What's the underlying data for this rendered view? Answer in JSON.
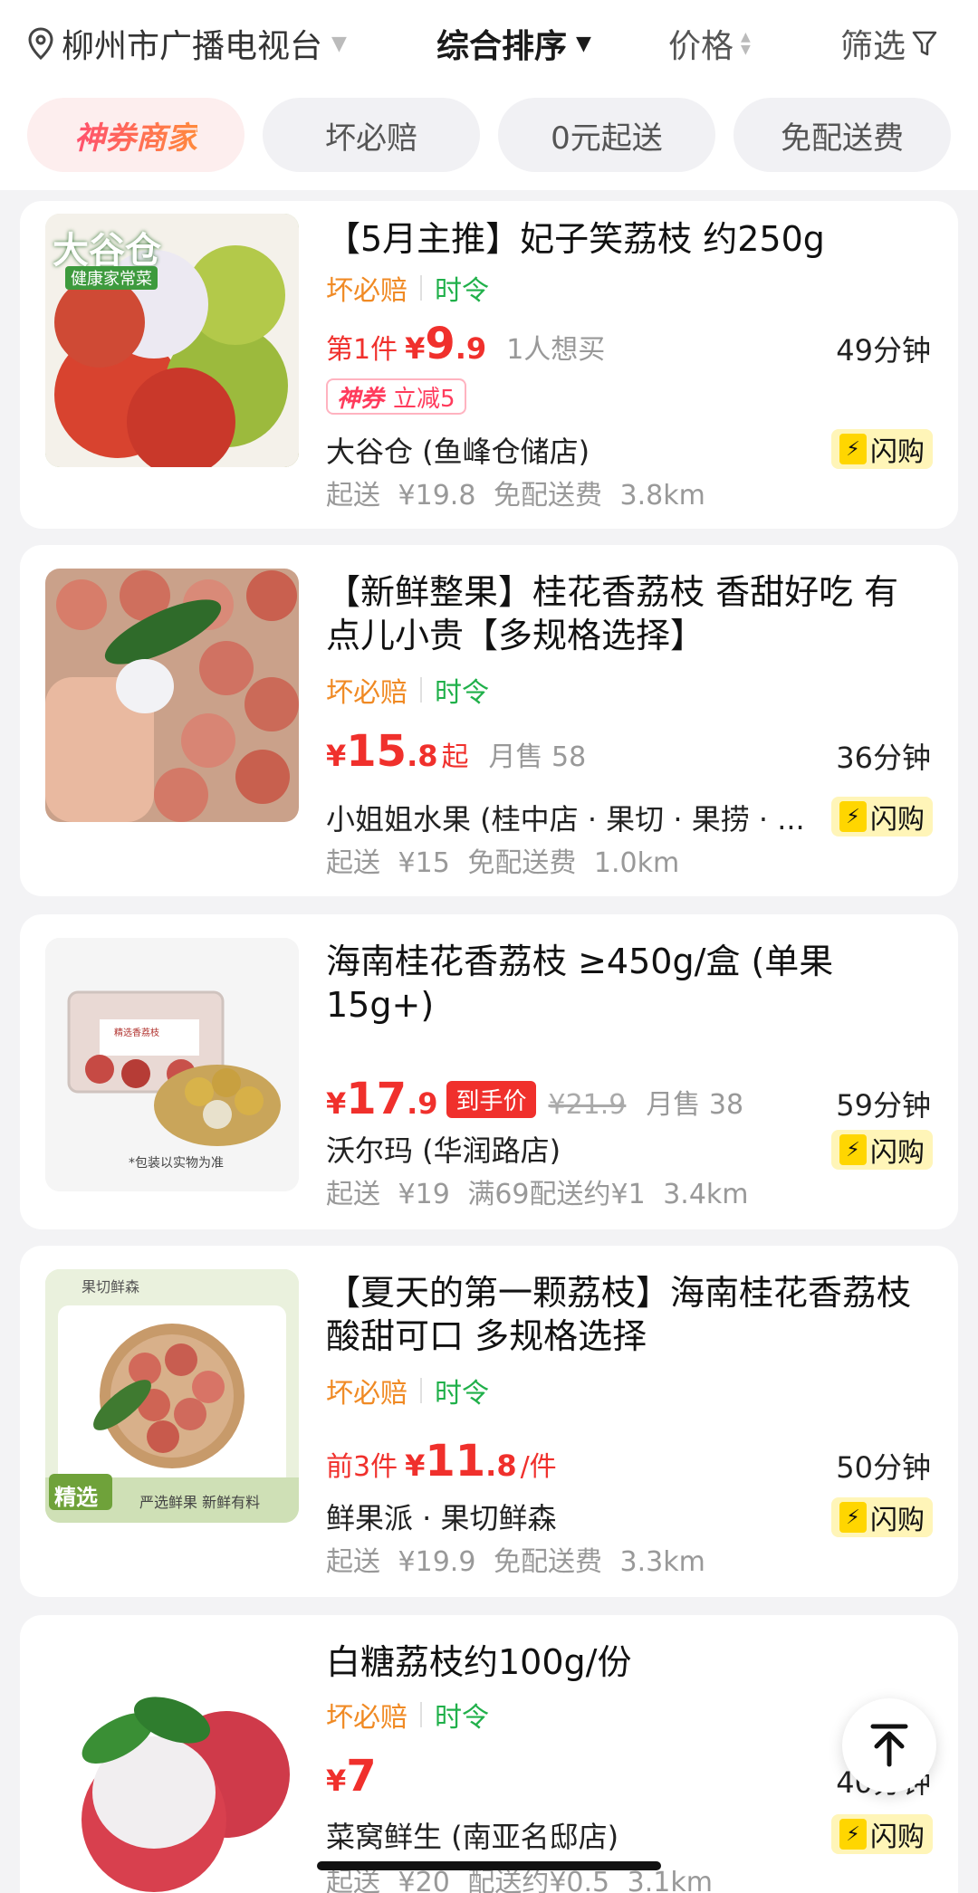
{
  "topbar": {
    "location": "柳州市广播电视台",
    "sort": "综合排序",
    "price": "价格",
    "filter": "筛选"
  },
  "chips": [
    "神券商家",
    "坏必赔",
    "0元起送",
    "免配送费"
  ],
  "products": [
    {
      "title": "【5月主推】妃子笑荔枝 约250g",
      "tag_guarantee": "坏必赔",
      "tag_season": "时令",
      "price_prefix": "第1件",
      "yen": "¥",
      "price_int": "9",
      "price_dec": ".9",
      "extra": "1人想买",
      "coupon_brand": "神券",
      "coupon_text": "立减5",
      "eta": "49分钟",
      "store": "大谷仓 (鱼峰仓储店)",
      "delivery": "起送 ¥19.8  免配送费  3.8km",
      "flash": "闪购",
      "thumb_brand": "大谷仓",
      "thumb_sub": "健康家常菜"
    },
    {
      "title": "【新鲜整果】桂花香荔枝 香甜好吃 有点儿小贵【多规格选择】",
      "tag_guarantee": "坏必赔",
      "tag_season": "时令",
      "yen": "¥",
      "price_int": "15",
      "price_dec": ".8",
      "price_suffix": "起",
      "extra": "月售 58",
      "eta": "36分钟",
      "store": "小姐姐水果 (桂中店 · 果切 · 果捞 · ...",
      "delivery": "起送 ¥15  免配送费  1.0km",
      "flash": "闪购"
    },
    {
      "title": "海南桂花香荔枝 ≥450g/盒 (单果15g+)",
      "yen": "¥",
      "price_int": "17",
      "price_dec": ".9",
      "hand_price": "到手价",
      "original": "¥21.9",
      "extra": "月售 38",
      "eta": "59分钟",
      "store": "沃尔玛 (华润路店)",
      "delivery": "起送 ¥19  满69配送约¥1  3.4km",
      "flash": "闪购",
      "thumb_note": "*包装以实物为准",
      "thumb_box_label": "精选香荔枝"
    },
    {
      "title": "【夏天的第一颗荔枝】海南桂花香荔枝 酸甜可口 多规格选择",
      "tag_guarantee": "坏必赔",
      "tag_season": "时令",
      "price_prefix": "前3件",
      "yen": "¥",
      "price_int": "11",
      "price_dec": ".8",
      "price_suffix": "/件",
      "eta": "50分钟",
      "store": "鲜果派 · 果切鲜森",
      "delivery": "起送 ¥19.9  免配送费  3.3km",
      "flash": "闪购",
      "thumb_brand": "果切鲜森",
      "thumb_badge": "精选",
      "thumb_slogan": "严选鲜果 新鲜有料"
    },
    {
      "title": "白糖荔枝约100g/份",
      "tag_guarantee": "坏必赔",
      "tag_season": "时令",
      "yen": "¥",
      "price_int": "7",
      "eta": "40分钟",
      "store": "菜窝鲜生 (南亚名邸店)",
      "delivery": "起送 ¥20  配送约¥0.5  3.1km",
      "flash": "闪购"
    }
  ],
  "colors": {
    "price_red": "#f0302c",
    "guarantee_orange": "#f08a24",
    "season_green": "#20b04a",
    "flash_yellow": "#ffd600"
  },
  "icons": [
    "location-pin-icon",
    "chevron-down-icon",
    "sort-updown-icon",
    "filter-funnel-icon",
    "bolt-icon",
    "back-to-top-icon"
  ]
}
